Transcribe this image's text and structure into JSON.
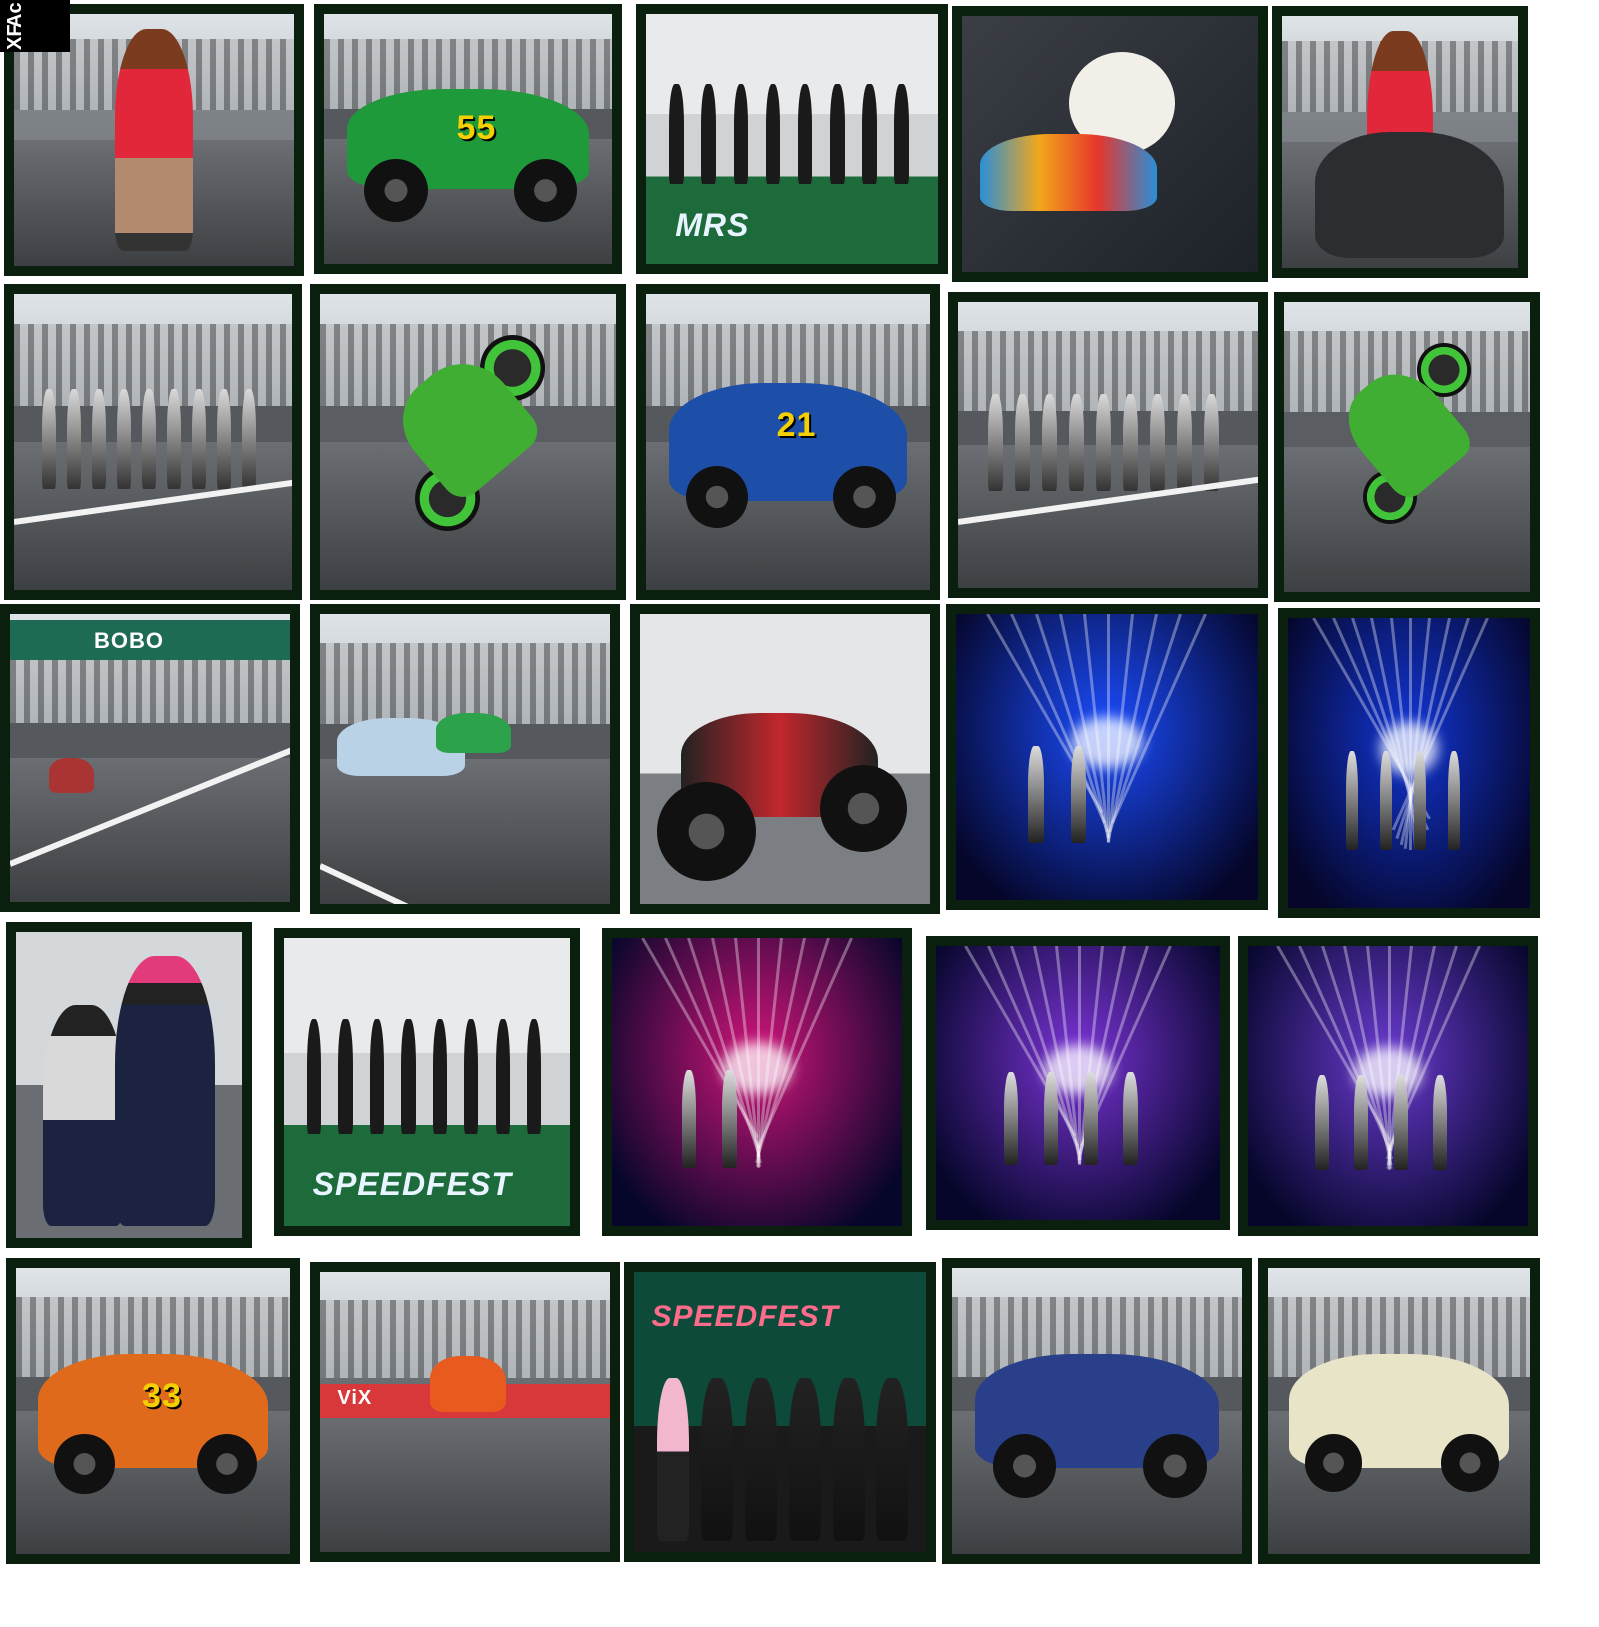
{
  "corner_label": {
    "line1": "Ac",
    "line2": "XF"
  },
  "photos": [
    {
      "name": "woman-red-outfit-photo",
      "type": "portrait",
      "scene": "paddock"
    },
    {
      "name": "green-race-car-55-photo",
      "type": "car",
      "car_color": "#1f9a3a",
      "number": "55"
    },
    {
      "name": "stage-dancers-photo",
      "type": "stage",
      "banner": "MRS"
    },
    {
      "name": "stuffed-toy-motorcycle-photo",
      "type": "closeup"
    },
    {
      "name": "girl-on-motorcycle-photo",
      "type": "portrait",
      "scene": "motorcycle"
    },
    {
      "name": "grid-girls-walking-photo-1",
      "type": "grid_girls"
    },
    {
      "name": "green-motorcycle-wheelie-photo-1",
      "type": "wheelie"
    },
    {
      "name": "blue-race-car-21-photo",
      "type": "car",
      "car_color": "#1d4fa8",
      "number": "21"
    },
    {
      "name": "grid-girls-walking-photo-2",
      "type": "grid_girls"
    },
    {
      "name": "green-motorcycle-wheelie-photo-2",
      "type": "wheelie"
    },
    {
      "name": "bobo-bridge-motorcycles-photo",
      "type": "bridge",
      "banner": "BOBO"
    },
    {
      "name": "race-cars-on-track-photo",
      "type": "track_cars"
    },
    {
      "name": "red-motorcycle-parked-photo",
      "type": "moto_parked"
    },
    {
      "name": "blue-concert-lights-photo",
      "type": "concert",
      "light_color": "#1a4cff"
    },
    {
      "name": "blue-stage-performers-photo",
      "type": "concert_performers",
      "light_color": "#1236d6"
    },
    {
      "name": "couple-racing-suit-photo",
      "type": "couple"
    },
    {
      "name": "mariachi-stage-photo",
      "type": "mariachi",
      "banner": "SPEEDFEST"
    },
    {
      "name": "pink-stage-singer-photo",
      "type": "concert",
      "light_color": "#d0147a"
    },
    {
      "name": "purple-stage-dancers-photo-1",
      "type": "concert_performers",
      "light_color": "#7a33d6"
    },
    {
      "name": "purple-stage-dancers-photo-2",
      "type": "concert_performers",
      "light_color": "#6a3ad0"
    },
    {
      "name": "orange-race-car-33-photo",
      "type": "car",
      "car_color": "#e06a1c",
      "number": "33"
    },
    {
      "name": "dirt-bike-vix-photo",
      "type": "dirtbike",
      "banner": "ViX"
    },
    {
      "name": "speedfest-group-photo",
      "type": "group",
      "banner": "SPEEDFEST"
    },
    {
      "name": "turbo-race-car-photo",
      "type": "car",
      "car_color": "#2a3f8a",
      "number": ""
    },
    {
      "name": "white-race-car-pit-photo",
      "type": "car",
      "car_color": "#e8e4c8",
      "number": ""
    }
  ]
}
